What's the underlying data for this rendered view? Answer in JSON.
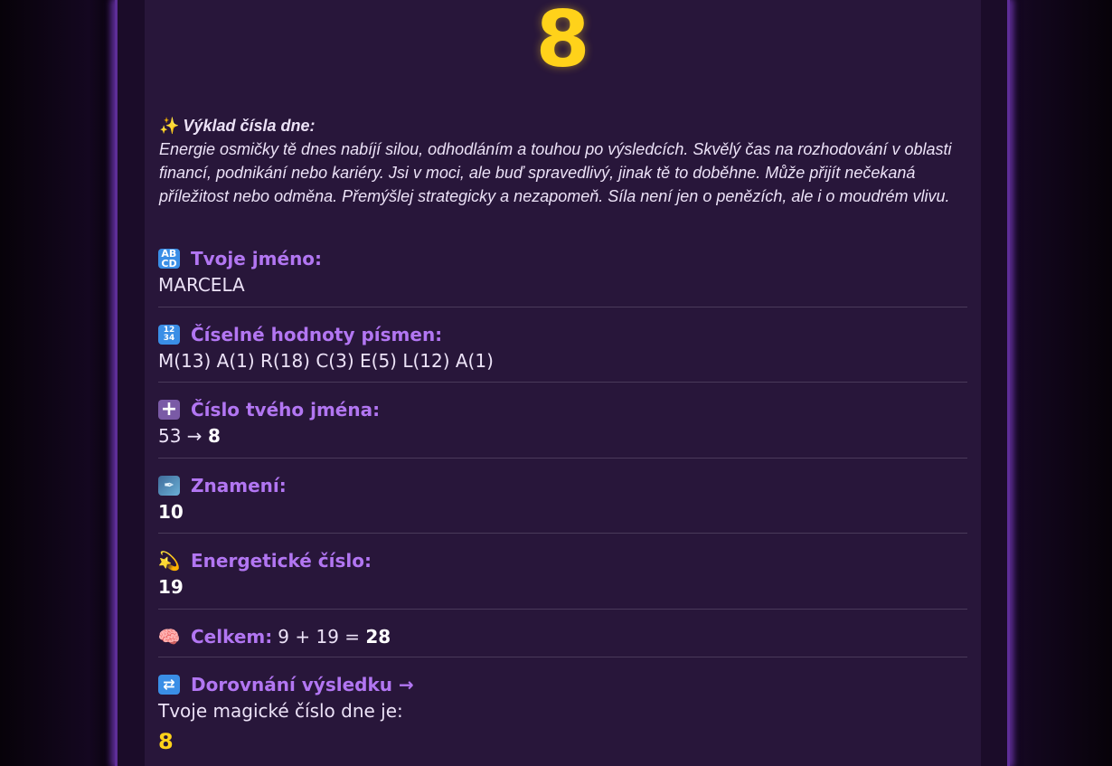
{
  "hero": {
    "number": "8"
  },
  "interpretation": {
    "icon": "sparkles-icon",
    "title": "Výklad čísla dne:",
    "text": "Energie osmičky tě dnes nabíjí silou, odhodláním a touhou po výsledcích. Skvělý čas na rozhodování v oblasti financí, podnikání nebo kariéry. Jsi v moci, ale buď spravedlivý, jinak tě to doběhne. Může přijít nečekaná příležitost nebo odměna. Přemýšlej strategicky a nezapomeň. Síla není jen o penězích, ale i o moudrém vlivu."
  },
  "name": {
    "icon": "abcd-icon",
    "label": "Tvoje jméno:",
    "value": "MARCELA"
  },
  "letters": {
    "icon": "numbers-1234-icon",
    "label": "Číselné hodnoty písmen:",
    "value": "M(13) A(1) R(18) C(3) E(5) L(12) A(1)"
  },
  "name_number": {
    "icon": "plus-icon",
    "label": "Číslo tvého jména:",
    "sum": "53 →",
    "result": "8"
  },
  "sign": {
    "icon": "feather-icon",
    "label": "Znamení:",
    "value": "10"
  },
  "energy": {
    "icon": "dizzy-icon",
    "label": "Energetické číslo:",
    "value": "19"
  },
  "total": {
    "icon": "brain-icon",
    "label": "Celkem:",
    "expression": "9 + 19 =",
    "result": "28"
  },
  "reduction": {
    "icon": "repeat-icon",
    "label": "Dorovnání výsledku →",
    "text": "Tvoje magické číslo dne je:",
    "result": "8"
  },
  "colors": {
    "accent_gold": "#ffd21a",
    "label_purple": "#b276f2",
    "card_bg": "#28163a",
    "glow": "#5a2c91"
  }
}
